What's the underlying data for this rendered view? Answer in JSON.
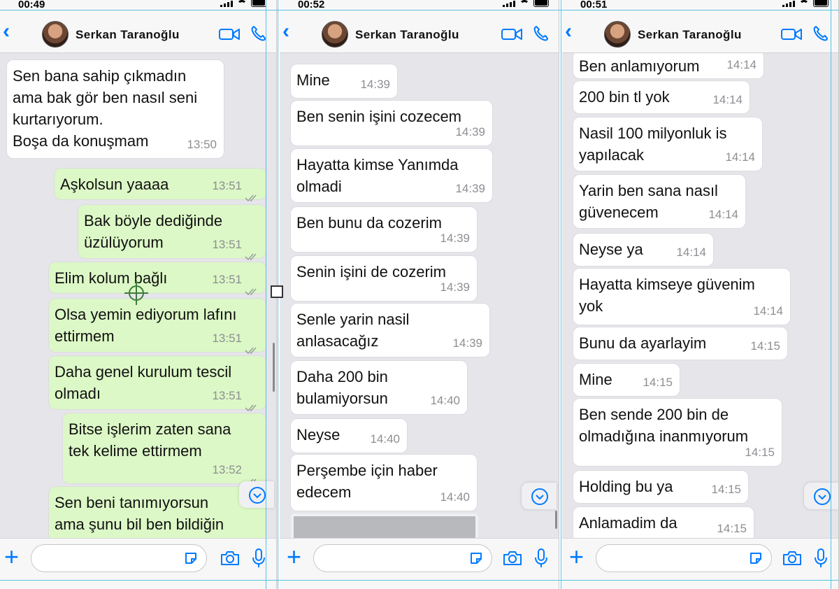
{
  "contact_name": "Serkan Taranoğlu",
  "colors": {
    "accent": "#007aff",
    "outgoing_bubble": "#dcf8c6",
    "incoming_bubble": "#ffffff",
    "chat_background": "#e5e5ea"
  },
  "icons": [
    "back-chevron-icon",
    "video-call-icon",
    "phone-icon",
    "plus-icon",
    "sticker-icon",
    "camera-icon",
    "microphone-icon",
    "read-ticks-icon",
    "scroll-down-icon"
  ],
  "panels": [
    {
      "time": "00:49",
      "messages": [
        {
          "text": "Sen bana sahip çıkmadın\nama bak gör ben nasıl seni\nkurtarıyorum.\nBoşa da konuşmam",
          "time": "13:50",
          "dir": "in"
        },
        {
          "text": "Aşkolsun yaaaa",
          "time": "13:51",
          "dir": "out"
        },
        {
          "text": "Bak böyle dediğinde\nüzülüyorum",
          "time": "13:51",
          "dir": "out"
        },
        {
          "text": "Elim kolum bağlı",
          "time": "13:51",
          "dir": "out"
        },
        {
          "text": "Olsa yemin ediyorum lafını\nettirmem",
          "time": "13:51",
          "dir": "out"
        },
        {
          "text": "Daha genel kurulum tescil\nolmadı",
          "time": "13:51",
          "dir": "out"
        },
        {
          "text": "Bitse işlerim zaten sana\ntek kelime ettirmem",
          "time": "13:52",
          "dir": "out"
        },
        {
          "text": "Sen beni tanımıyorsun\nama şunu bil ben bildiğin",
          "time": "",
          "dir": "out"
        }
      ]
    },
    {
      "time": "00:52",
      "messages": [
        {
          "text": "Mine",
          "time": "14:39",
          "dir": "in"
        },
        {
          "text": "Ben senin işini cozecem",
          "time": "14:39",
          "dir": "in"
        },
        {
          "text": "Hayatta kimse Yanımda\nolmadi",
          "time": "14:39",
          "dir": "in"
        },
        {
          "text": "Ben bunu da cozerim",
          "time": "14:39",
          "dir": "in"
        },
        {
          "text": "Senin işini de cozerim",
          "time": "14:39",
          "dir": "in"
        },
        {
          "text": "Senle yarin nasil\nanlasacağız",
          "time": "14:39",
          "dir": "in"
        },
        {
          "text": "Daha 200 bin\nbulamiyorsun",
          "time": "14:40",
          "dir": "in"
        },
        {
          "text": "Neyse",
          "time": "14:40",
          "dir": "in"
        },
        {
          "text": "Perşembe için haber\nedecem",
          "time": "14:40",
          "dir": "in"
        }
      ]
    },
    {
      "time": "00:51",
      "messages": [
        {
          "text": "Ben anlamıyorum",
          "time": "14:14",
          "dir": "in"
        },
        {
          "text": "200 bin tl yok",
          "time": "14:14",
          "dir": "in"
        },
        {
          "text": "Nasil 100 milyonluk is\nyapılacak",
          "time": "14:14",
          "dir": "in"
        },
        {
          "text": "Yarin ben sana nasıl\ngüvenecem",
          "time": "14:14",
          "dir": "in"
        },
        {
          "text": "Neyse ya",
          "time": "14:14",
          "dir": "in"
        },
        {
          "text": "Hayatta kimseye güvenim\nyok",
          "time": "14:14",
          "dir": "in"
        },
        {
          "text": "Bunu da ayarlayim",
          "time": "14:15",
          "dir": "in"
        },
        {
          "text": "Mine",
          "time": "14:15",
          "dir": "in"
        },
        {
          "text": "Ben sende 200 bin de\nolmadığına inanmıyorum",
          "time": "14:15",
          "dir": "in"
        },
        {
          "text": "Holding bu ya",
          "time": "14:15",
          "dir": "in"
        },
        {
          "text": "Anlamadim da",
          "time": "14:15",
          "dir": "in"
        }
      ]
    }
  ]
}
